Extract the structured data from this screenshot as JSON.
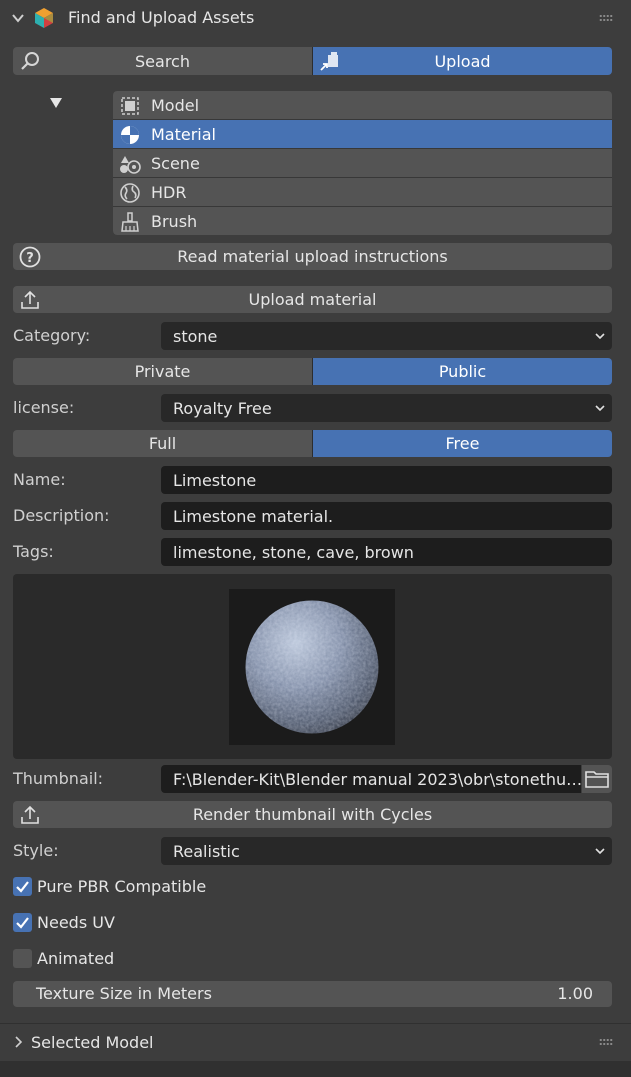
{
  "header": {
    "title": "Find and Upload Assets",
    "logo_icon": "blenderkit-cube-icon",
    "collapse_icon": "chevron-down-icon"
  },
  "mode_tabs": [
    {
      "label": "Search",
      "icon": "search-icon",
      "active": false
    },
    {
      "label": "Upload",
      "icon": "upload-box-icon",
      "active": true
    }
  ],
  "asset_types": [
    {
      "label": "Model",
      "icon": "model-icon",
      "selected": false
    },
    {
      "label": "Material",
      "icon": "material-sphere-icon",
      "selected": true
    },
    {
      "label": "Scene",
      "icon": "scene-icon",
      "selected": false
    },
    {
      "label": "HDR",
      "icon": "world-globe-icon",
      "selected": false
    },
    {
      "label": "Brush",
      "icon": "brush-icon",
      "selected": false
    }
  ],
  "instructions_button": {
    "label": "Read material upload instructions",
    "icon": "question-icon"
  },
  "upload_button": {
    "label": "Upload material",
    "icon": "upload-arrow-icon"
  },
  "category": {
    "label": "Category:",
    "value": "stone"
  },
  "visibility": [
    {
      "label": "Private",
      "active": false
    },
    {
      "label": "Public",
      "active": true
    }
  ],
  "license": {
    "label": "license:",
    "value": "Royalty Free"
  },
  "plan": [
    {
      "label": "Full",
      "active": false
    },
    {
      "label": "Free",
      "active": true
    }
  ],
  "name": {
    "label": "Name:",
    "value": "Limestone"
  },
  "description": {
    "label": "Description:",
    "value": "Limestone material."
  },
  "tags": {
    "label": "Tags:",
    "value": "limestone, stone, cave, brown"
  },
  "thumbnail": {
    "label": "Thumbnail:",
    "value": "F:\\Blender-Kit\\Blender manual 2023\\obr\\stonethu…",
    "folder_icon": "folder-icon"
  },
  "render_button": {
    "label": "Render thumbnail with Cycles",
    "icon": "upload-arrow-icon"
  },
  "style": {
    "label": "Style:",
    "value": "Realistic"
  },
  "checkboxes": [
    {
      "label": "Pure PBR Compatible",
      "checked": true
    },
    {
      "label": "Needs UV",
      "checked": true
    },
    {
      "label": "Animated",
      "checked": false
    }
  ],
  "texture_size": {
    "label": "Texture Size in Meters",
    "value": "1.00"
  },
  "footer": {
    "title": "Selected Model",
    "expand_icon": "chevron-right-icon"
  },
  "colors": {
    "accent": "#4772b3",
    "panel": "#3d3d3d",
    "button": "#545454",
    "field": "#1d1d1d"
  }
}
